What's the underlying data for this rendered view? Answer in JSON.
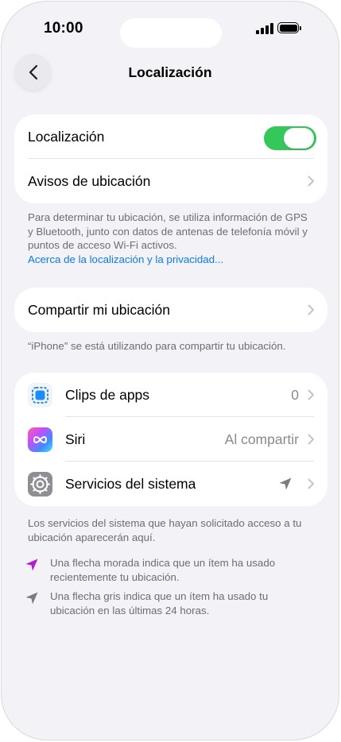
{
  "status_bar": {
    "time": "10:00"
  },
  "nav": {
    "title": "Localización"
  },
  "group1": {
    "location_label": "Localización",
    "location_enabled": true,
    "alerts_label": "Avisos de ubicación"
  },
  "footer1": {
    "text": "Para determinar tu ubicación, se utiliza información de GPS y Bluetooth, junto con datos de antenas de telefonía móvil y puntos de acceso Wi-Fi activos.",
    "link": "Acerca de la localización y la privacidad..."
  },
  "group2": {
    "share_label": "Compartir mi ubicación"
  },
  "footer2": {
    "text": "“iPhone” se está utilizando para compartir tu ubicación."
  },
  "group3": {
    "items": [
      {
        "label": "Clips de apps",
        "value": "0",
        "icon": "app-clips-icon"
      },
      {
        "label": "Siri",
        "value": "Al compartir",
        "icon": "siri-icon"
      },
      {
        "label": "Servicios del sistema",
        "value": "",
        "icon": "gear-icon"
      }
    ]
  },
  "footer3": {
    "text": "Los servicios del sistema que hayan solicitado acceso a tu ubicación aparecerán aquí."
  },
  "legend": {
    "purple_text": "Una flecha morada indica que un ítem ha usado recientemente tu ubicación.",
    "gray_text": "Una flecha gris indica que un ítem ha usado tu ubicación en las últimas 24 horas."
  },
  "colors": {
    "toggle_on": "#34c759",
    "link": "#0a7aff",
    "purple_arrow": "#b51ad6",
    "gray_arrow": "#7b7b80"
  }
}
